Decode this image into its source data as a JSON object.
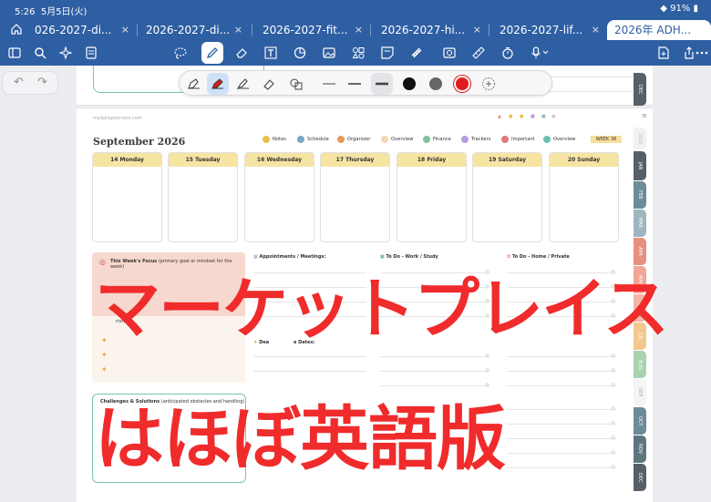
{
  "status": {
    "time": "5:26",
    "date": "5月5日(火)",
    "battery": "91%"
  },
  "tabs": [
    {
      "label": "026-2027-di..."
    },
    {
      "label": "2026-2027-di..."
    },
    {
      "label": "2026-2027-fit..."
    },
    {
      "label": "2026-2027-hi..."
    },
    {
      "label": "2026-2027-lif..."
    },
    {
      "label": "2026年 ADH...",
      "active": true
    }
  ],
  "tab_close": "×",
  "toolbar_icons": [
    "sidebar-icon",
    "search-icon",
    "sparkle-icon",
    "document-icon",
    "lasso-icon",
    "pen-icon",
    "eraser-icon",
    "text-box-icon",
    "shape-icon",
    "image-icon",
    "sticker-icon",
    "note-icon",
    "tape-icon",
    "capture-icon",
    "ruler-icon",
    "timer-icon",
    "microphone-icon",
    "add-page-icon",
    "share-icon",
    "more-icon"
  ],
  "pen_colors": {
    "black": "#111111",
    "gray": "#666666",
    "red": "#e01c1c"
  },
  "colors": {
    "accent": "#2f5fa3",
    "overlay_text": "#f02b2b",
    "day_header": "#f6e4a3"
  },
  "planner": {
    "site": "mydailyplanners.com",
    "title": "September 2026",
    "nav": [
      "Notes",
      "Schedule",
      "Organizer",
      "Overview",
      "Finance",
      "Trackers",
      "Important",
      "Overview"
    ],
    "week": "WEEK 38",
    "days": [
      "14 Monday",
      "15 Tuesday",
      "16 Wednesday",
      "17 Thursday",
      "18 Friday",
      "19 Saturday",
      "20 Sunday"
    ],
    "focus_title": "This Week's Focus",
    "focus_sub": "(primary goal or mindset for the week)",
    "appointments": "Appointments / Meetings:",
    "todo_work": "To Do - Work / Study",
    "todo_home": "To Do - Home / Private",
    "priorities_partial": "riorit",
    "deadlines_partial_a": "Dea",
    "deadlines_partial_b": "e Dates:",
    "challenges_title": "Challenges & Solutions",
    "challenges_sub": "(anticipated obstacles and handling)"
  },
  "side_tabs": [
    "DEC",
    "2026",
    "JAN",
    "FEB",
    "MAR",
    "APR",
    "MAY",
    "JUN",
    "JUL",
    "AUG",
    "SEP",
    "OCT",
    "NOV",
    "DEC"
  ],
  "overlay": {
    "line1": "マーケットプレイス",
    "line2": "はほぼ英語版"
  }
}
